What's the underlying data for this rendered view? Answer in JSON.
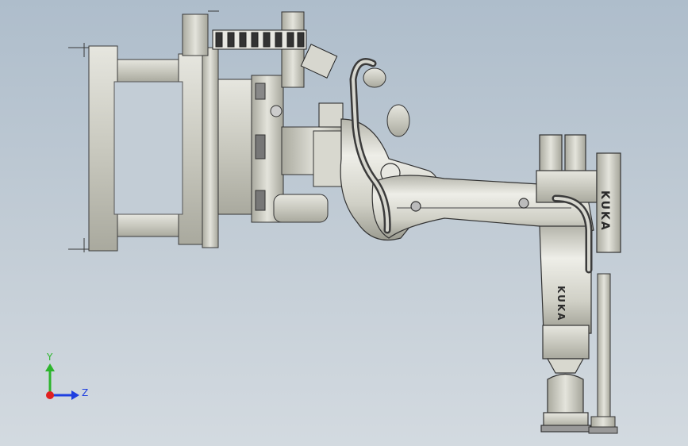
{
  "viewer": {
    "background_top": "#aebdcb",
    "background_bottom": "#d3dae0"
  },
  "model": {
    "brand_label_upper_arm": "KUKA",
    "brand_label_forearm": "KUKA",
    "part_fill": "#cfcfc5",
    "edge_color": "#3a3a3a"
  },
  "triad": {
    "y_label": "Y",
    "z_label": "Z",
    "y_color": "#2db52d",
    "z_color": "#1e3fe0",
    "x_color": "#e02020"
  }
}
